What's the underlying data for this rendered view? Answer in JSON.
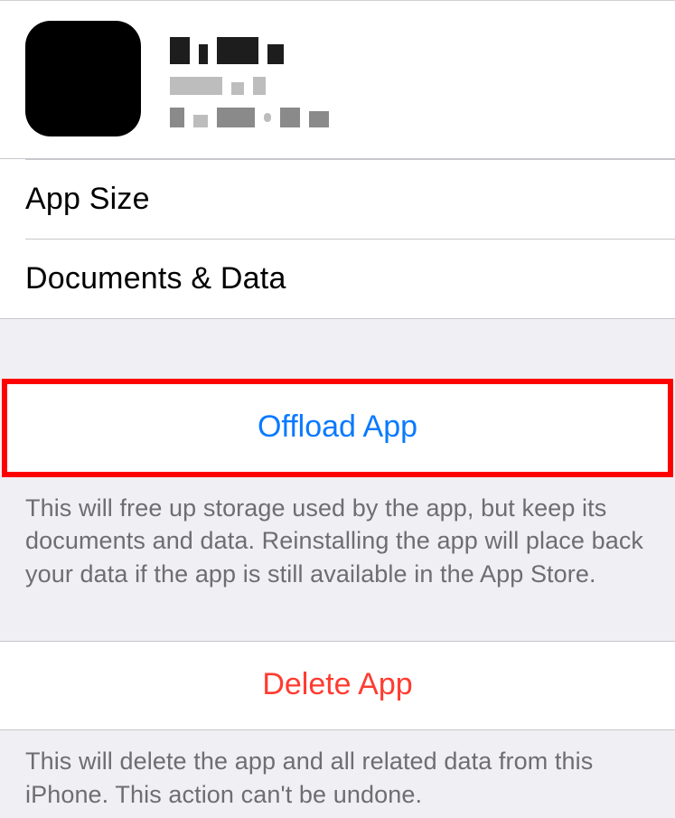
{
  "app": {
    "name_redacted": true,
    "version_redacted": true,
    "vendor_redacted": true
  },
  "rows": {
    "app_size_label": "App Size",
    "documents_data_label": "Documents & Data"
  },
  "offload": {
    "button_label": "Offload App",
    "description": "This will free up storage used by the app, but keep its documents and data. Reinstalling the app will place back your data if the app is still available in the App Store."
  },
  "delete": {
    "button_label": "Delete App",
    "description": "This will delete the app and all related data from this iPhone. This action can't be undone."
  }
}
